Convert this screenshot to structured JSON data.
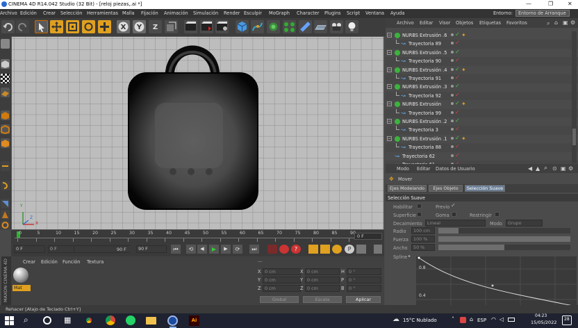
{
  "window": {
    "title": "CINEMA 4D R14.042 Studio (32 Bit) - [reloj piezas,.ai *]",
    "minimize": "—",
    "maximize": "❐",
    "close": "✕"
  },
  "menu": [
    "Archivo",
    "Edición",
    "Crear",
    "Selección",
    "Herramientas",
    "Malla",
    "Fijación",
    "Animación",
    "Simulación",
    "Render",
    "Esculpir",
    "MoGraph",
    "Character",
    "Plugins",
    "Script",
    "Ventana",
    "Ayuda"
  ],
  "layout": {
    "label": "Entorno:",
    "value": "Entorno de Arranque"
  },
  "viewport": {
    "axis_labels": [
      "Y",
      "X",
      "Z"
    ]
  },
  "timeline": {
    "ticks": [
      "0",
      "5",
      "10",
      "15",
      "20",
      "25",
      "30",
      "35",
      "40",
      "45",
      "50",
      "55",
      "60",
      "65",
      "70",
      "75",
      "80",
      "85",
      "90"
    ],
    "end_label": "0 F"
  },
  "transport": {
    "start": "0 F",
    "current": "0 F",
    "max": "90 F",
    "end": "90 F"
  },
  "materials": {
    "menu": [
      "Crear",
      "Edición",
      "Función",
      "Textura"
    ],
    "items": [
      {
        "name": "Mat"
      }
    ],
    "vertical_label": "MAXON CINEMA 4D"
  },
  "coords": {
    "header": "—",
    "rows": [
      {
        "axis": "X",
        "pos": "0 cm",
        "size": "0 cm",
        "rot_label": "H",
        "rot": "0 °"
      },
      {
        "axis": "Y",
        "pos": "0 cm",
        "size": "0 cm",
        "rot_label": "P",
        "rot": "0 °"
      },
      {
        "axis": "Z",
        "pos": "0 cm",
        "size": "0 cm",
        "rot_label": "B",
        "rot": "0 °"
      }
    ],
    "mode": "Global",
    "scale": "Escala",
    "apply": "Aplicar"
  },
  "objects": {
    "menu": [
      "Archivo",
      "Editar",
      "Visor",
      "Objetos",
      "Etiquetas",
      "Favoritos"
    ],
    "rows": [
      {
        "name": "NURBS Extrusión .6",
        "child": false
      },
      {
        "name": "Trayectoria 89",
        "child": true
      },
      {
        "name": "NURBS Extrusión .5",
        "child": false
      },
      {
        "name": "Trayectoria 90",
        "child": true
      },
      {
        "name": "NURBS Extrusión .4",
        "child": false
      },
      {
        "name": "Trayectoria 91",
        "child": true
      },
      {
        "name": "NURBS Extrusión .3",
        "child": false
      },
      {
        "name": "Trayectoria 92",
        "child": true
      },
      {
        "name": "NURBS Extrusión",
        "child": false
      },
      {
        "name": "Trayectoria 99",
        "child": true
      },
      {
        "name": "NURBS Extrusión .2",
        "child": false
      },
      {
        "name": "Trayectoria 3",
        "child": true
      },
      {
        "name": "NURBS Extrusión .1",
        "child": false
      },
      {
        "name": "Trayectoria 88",
        "child": true
      },
      {
        "name": "Trayectoria 62",
        "child": false
      },
      {
        "name": "Trayectoria 61",
        "child": false
      }
    ]
  },
  "attributes": {
    "menu": [
      "Modo",
      "Editar",
      "Datos de Usuario"
    ],
    "tool": "Mover",
    "tabs": [
      "Ejes Modelando",
      "Ejes Objeto",
      "Selección Suave"
    ],
    "active_tab": "Selección Suave",
    "section": "Selección Suave",
    "habilitar": "Habilitar",
    "previo": "Previo",
    "superficie": "Superficie",
    "goma": "Goma",
    "restringir": "Restringir",
    "decaimiento_label": "Decaimiento",
    "decaimiento": "Lineal",
    "modo_label": "Modo",
    "modo": "Grupo",
    "radio_label": "Radio",
    "radio": "100 cm",
    "radio_fill": 0.15,
    "fuerza_label": "Fuerza",
    "fuerza": "100 %",
    "fuerza_fill": 1.0,
    "ancho_label": "Ancho",
    "ancho": "50 %",
    "ancho_fill": 0.5,
    "spline_label": "Spline",
    "graph_ticks": [
      "0.8",
      "0.4"
    ]
  },
  "status": "Rehacer [Atajo de Teclado Ctrl+Y]",
  "taskbar": {
    "weather": "15°C  Nublado",
    "lang": "ESP",
    "time": "04:23",
    "date": "15/05/2022",
    "badge": "28"
  }
}
